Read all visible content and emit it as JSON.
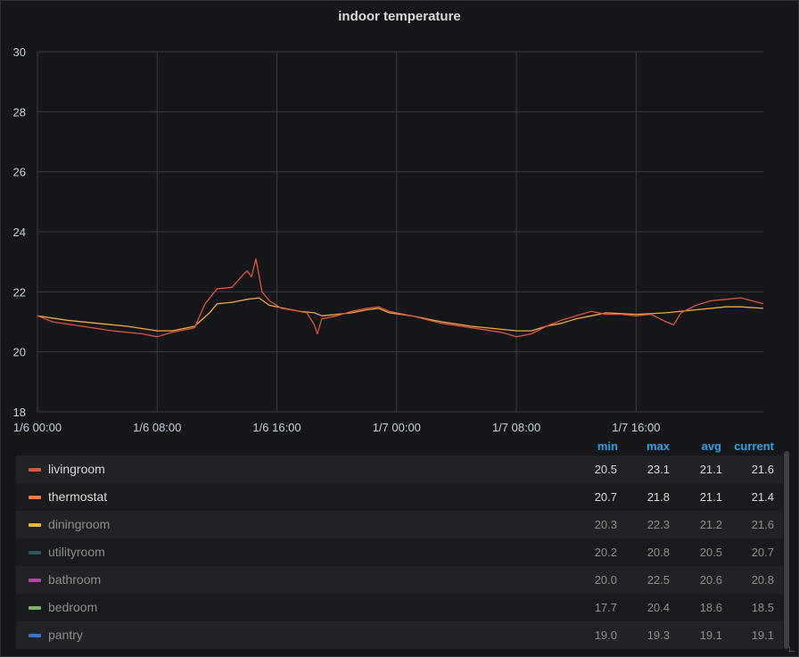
{
  "panel": {
    "title": "indoor temperature"
  },
  "legend": {
    "headers": {
      "min": "min",
      "max": "max",
      "avg": "avg",
      "current": "current"
    },
    "rows": [
      {
        "name": "livingroom",
        "color": "#e2533f",
        "min": "20.5",
        "max": "23.1",
        "avg": "21.1",
        "current": "21.6",
        "hidden": false
      },
      {
        "name": "thermostat",
        "color": "#f07a42",
        "min": "20.7",
        "max": "21.8",
        "avg": "21.1",
        "current": "21.4",
        "hidden": false
      },
      {
        "name": "diningroom",
        "color": "#eab839",
        "min": "20.3",
        "max": "22.3",
        "avg": "21.2",
        "current": "21.6",
        "hidden": true
      },
      {
        "name": "utilityroom",
        "color": "#2f575e",
        "min": "20.2",
        "max": "20.8",
        "avg": "20.5",
        "current": "20.7",
        "hidden": true
      },
      {
        "name": "bathroom",
        "color": "#ba43a9",
        "min": "20.0",
        "max": "22.5",
        "avg": "20.6",
        "current": "20.8",
        "hidden": true
      },
      {
        "name": "bedroom",
        "color": "#7eb26d",
        "min": "17.7",
        "max": "20.4",
        "avg": "18.6",
        "current": "18.5",
        "hidden": true
      },
      {
        "name": "pantry",
        "color": "#3274d9",
        "min": "19.0",
        "max": "19.3",
        "avg": "19.1",
        "current": "19.1",
        "hidden": true
      }
    ]
  },
  "chart_data": {
    "type": "line",
    "title": "indoor temperature",
    "xlim": [
      0,
      48.5
    ],
    "ylim": [
      18,
      30
    ],
    "grid": true,
    "legend_placement": "bottom",
    "x_tick_values": [
      0,
      8,
      16,
      24,
      32,
      40
    ],
    "x_tick_labels": [
      "1/6 00:00",
      "1/6 08:00",
      "1/6 16:00",
      "1/7 00:00",
      "1/7 08:00",
      "1/7 16:00"
    ],
    "y_ticks": [
      18,
      20,
      22,
      24,
      26,
      28,
      30
    ],
    "x_unit": "hours since 1/6 00:00",
    "series": [
      {
        "name": "livingroom",
        "color": "#e2533f",
        "x": [
          0,
          1,
          3,
          5,
          7,
          8,
          9,
          10.5,
          11.2,
          12,
          13,
          13.8,
          14,
          14.3,
          14.6,
          15,
          15.5,
          16.3,
          17.5,
          18,
          18.5,
          18.7,
          19,
          20,
          21,
          22,
          22.8,
          23.5,
          25,
          27,
          29,
          31,
          32,
          33,
          34,
          35,
          36,
          37,
          38,
          39,
          40,
          41,
          42,
          42.5,
          43,
          44,
          45,
          46,
          47,
          48.5
        ],
        "y": [
          21.2,
          21.0,
          20.85,
          20.7,
          20.6,
          20.5,
          20.65,
          20.8,
          21.6,
          22.1,
          22.15,
          22.6,
          22.7,
          22.5,
          23.1,
          22.0,
          21.7,
          21.45,
          21.35,
          21.3,
          20.9,
          20.6,
          21.1,
          21.2,
          21.35,
          21.45,
          21.5,
          21.35,
          21.2,
          20.95,
          20.8,
          20.65,
          20.5,
          20.6,
          20.85,
          21.05,
          21.2,
          21.35,
          21.25,
          21.25,
          21.2,
          21.25,
          21.0,
          20.9,
          21.3,
          21.55,
          21.7,
          21.75,
          21.8,
          21.6
        ]
      },
      {
        "name": "thermostat",
        "color": "#f4a742",
        "x": [
          0,
          2,
          4,
          6,
          8,
          9,
          10.5,
          11.5,
          12,
          13,
          14,
          14.8,
          15.5,
          16.5,
          17.5,
          18.5,
          19,
          20,
          21,
          22,
          22.8,
          23.5,
          25,
          27,
          29,
          31,
          32,
          33,
          34,
          35,
          36,
          37,
          38,
          40,
          42,
          44,
          46,
          47,
          48.5
        ],
        "y": [
          21.2,
          21.05,
          20.95,
          20.85,
          20.7,
          20.7,
          20.85,
          21.3,
          21.6,
          21.65,
          21.75,
          21.8,
          21.55,
          21.45,
          21.35,
          21.3,
          21.2,
          21.25,
          21.3,
          21.4,
          21.45,
          21.3,
          21.2,
          21.0,
          20.85,
          20.75,
          20.7,
          20.7,
          20.85,
          20.95,
          21.1,
          21.2,
          21.3,
          21.25,
          21.3,
          21.4,
          21.5,
          21.5,
          21.45
        ]
      }
    ]
  }
}
